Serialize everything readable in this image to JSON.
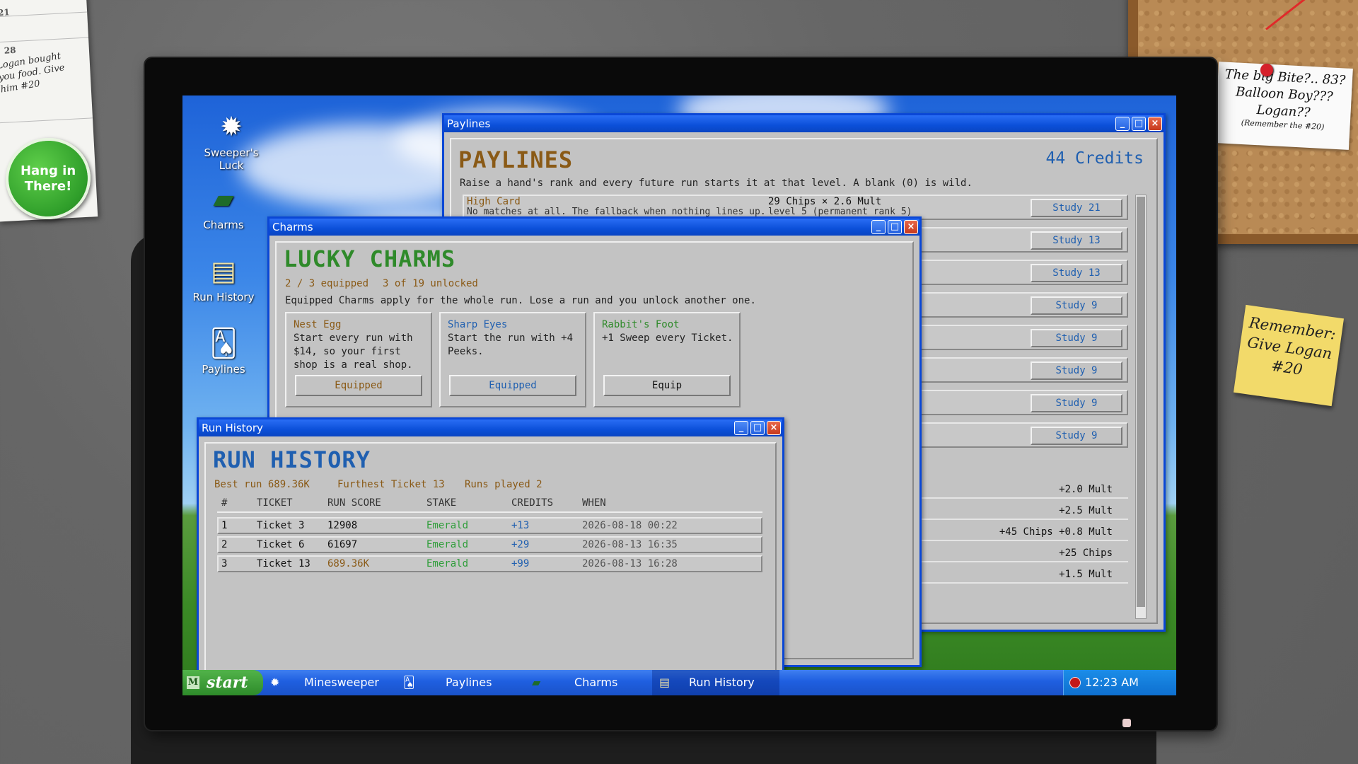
{
  "wall": {
    "calendar_numbers": [
      "21",
      "28"
    ],
    "calendar_note": "Logan bought you food. Give him #20",
    "badge": "Hang in There!",
    "cork_note_lines": [
      "The big Bite?.. 83?",
      "Balloon Boy???",
      "Logan??",
      "(Remember the #20)"
    ],
    "sticky_note": "Remember: Give Logan #20"
  },
  "desktop": {
    "icons": [
      {
        "label": "Sweeper's Luck",
        "icon": "bomb-icon"
      },
      {
        "label": "Charms",
        "icon": "book-icon"
      },
      {
        "label": "Run History",
        "icon": "scroll-icon"
      },
      {
        "label": "Paylines",
        "icon": "cards-icon"
      }
    ]
  },
  "paylines": {
    "window_title": "Paylines",
    "title": "PAYLINES",
    "credits": "44 Credits",
    "description": "Raise a hand's rank and every future run starts it at that level. A blank (0) is wild.",
    "first_row": {
      "name": "High Card",
      "stats": "29 Chips  ×  2.6 Mult",
      "desc": "No matches at all. The fallback when nothing lines up.",
      "level": "level 5   (permanent rank 5)"
    },
    "study_buttons": [
      "Study 21",
      "Study 13",
      "Study 13",
      "Study 9",
      "Study 9",
      "Study 9",
      "Study 9",
      "Study 9"
    ],
    "mult_rows": [
      "+2.0 Mult",
      "+2.5 Mult",
      "+45 Chips  +0.8 Mult",
      "+25 Chips",
      "+1.5 Mult"
    ]
  },
  "charms": {
    "window_title": "Charms",
    "title": "LUCKY CHARMS",
    "equipped": "2 / 3 equipped",
    "unlocked": "3 of 19 unlocked",
    "description": "Equipped Charms apply for the whole run. Lose a run and you unlock another one.",
    "cards": [
      {
        "name": "Nest Egg",
        "desc": "Start every run with $14, so your first shop is a real shop.",
        "button": "Equipped"
      },
      {
        "name": "Sharp Eyes",
        "desc": "Start the run with +4 Peeks.",
        "button": "Equipped"
      },
      {
        "name": "Rabbit's Foot",
        "desc": "+1 Sweep every Ticket.",
        "button": "Equip"
      }
    ]
  },
  "run_history": {
    "window_title": "Run History",
    "title": "RUN HISTORY",
    "best_run": "Best run 689.36K",
    "furthest": "Furthest Ticket 13",
    "runs_played": "Runs played 2",
    "columns": [
      "#",
      "TICKET",
      "RUN SCORE",
      "STAKE",
      "CREDITS",
      "WHEN"
    ],
    "rows": [
      {
        "n": "1",
        "ticket": "Ticket 3",
        "score": "12908",
        "stake": "Emerald",
        "credits": "+13",
        "when": "2026-08-18 00:22"
      },
      {
        "n": "2",
        "ticket": "Ticket 6",
        "score": "61697",
        "stake": "Emerald",
        "credits": "+29",
        "when": "2026-08-13 16:35"
      },
      {
        "n": "3",
        "ticket": "Ticket 13",
        "score": "689.36K",
        "stake": "Emerald",
        "credits": "+99",
        "when": "2026-08-13 16:28"
      }
    ]
  },
  "taskbar": {
    "start": "start",
    "start_logo": "M",
    "items": [
      "Minesweeper",
      "Paylines",
      "Charms",
      "Run History"
    ],
    "clock": "12:23 AM"
  },
  "colors": {
    "accent_blue": "#0a47d6",
    "title_gold": "#8a5a16",
    "title_green": "#2f8a2a",
    "title_blue": "#1f5fb0",
    "emerald": "#2f9e3a"
  }
}
